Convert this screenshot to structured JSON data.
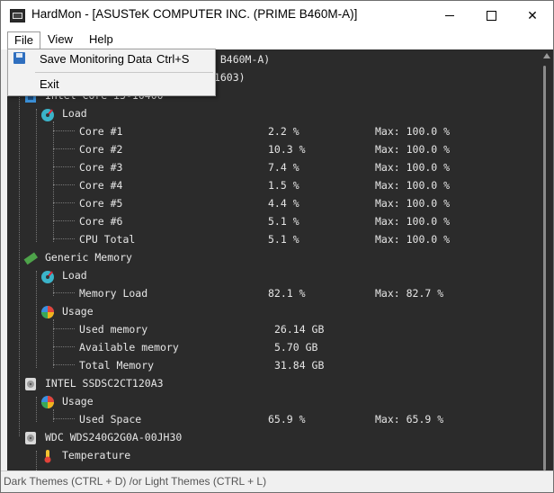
{
  "window": {
    "title": "HardMon - [ASUSTeK COMPUTER INC. (PRIME B460M-A)]",
    "minimize_glyph": "—",
    "close_glyph": "✕"
  },
  "menubar": {
    "file": "File",
    "view": "View",
    "help": "Help"
  },
  "file_menu": {
    "save_label": "Save Monitoring Data",
    "save_shortcut": "Ctrl+S",
    "exit_label": "Exit",
    "save_icon": "floppy-disk-icon"
  },
  "tree": {
    "root_partial": "E B460M-A)",
    "bios_partial": "(1603)",
    "cpu_partial": "Intel Core i5-10400",
    "cpu_load_label": "Load",
    "cores": [
      {
        "name": "Core #1",
        "value": "2.2 %",
        "max": "Max: 100.0 %"
      },
      {
        "name": "Core #2",
        "value": "10.3 %",
        "max": "Max: 100.0 %"
      },
      {
        "name": "Core #3",
        "value": "7.4 %",
        "max": "Max: 100.0 %"
      },
      {
        "name": "Core #4",
        "value": "1.5 %",
        "max": "Max: 100.0 %"
      },
      {
        "name": "Core #5",
        "value": "4.4 %",
        "max": "Max: 100.0 %"
      },
      {
        "name": "Core #6",
        "value": "5.1 %",
        "max": "Max: 100.0 %"
      },
      {
        "name": "CPU Total",
        "value": "5.1 %",
        "max": "Max: 100.0 %"
      }
    ],
    "memory": {
      "label": "Generic Memory",
      "load_label": "Load",
      "memory_load": {
        "name": "Memory Load",
        "value": "82.1 %",
        "max": "Max: 82.7 %"
      },
      "usage_label": "Usage",
      "used": {
        "name": "Used memory",
        "value": "26.14 GB"
      },
      "available": {
        "name": "Available memory",
        "value": "5.70 GB"
      },
      "total": {
        "name": "Total Memory",
        "value": "31.84 GB"
      }
    },
    "ssd": {
      "label": "INTEL SSDSC2CT120A3",
      "usage_label": "Usage",
      "used_space": {
        "name": "Used Space",
        "value": "65.9 %",
        "max": "Max: 65.9 %"
      }
    },
    "hdd": {
      "label": "WDC WDS240G2G0A-00JH30",
      "temperature_label": "Temperature"
    }
  },
  "status_bar": {
    "text": "Dark Themes (CTRL + D) /or Light Themes (CTRL + L)"
  }
}
